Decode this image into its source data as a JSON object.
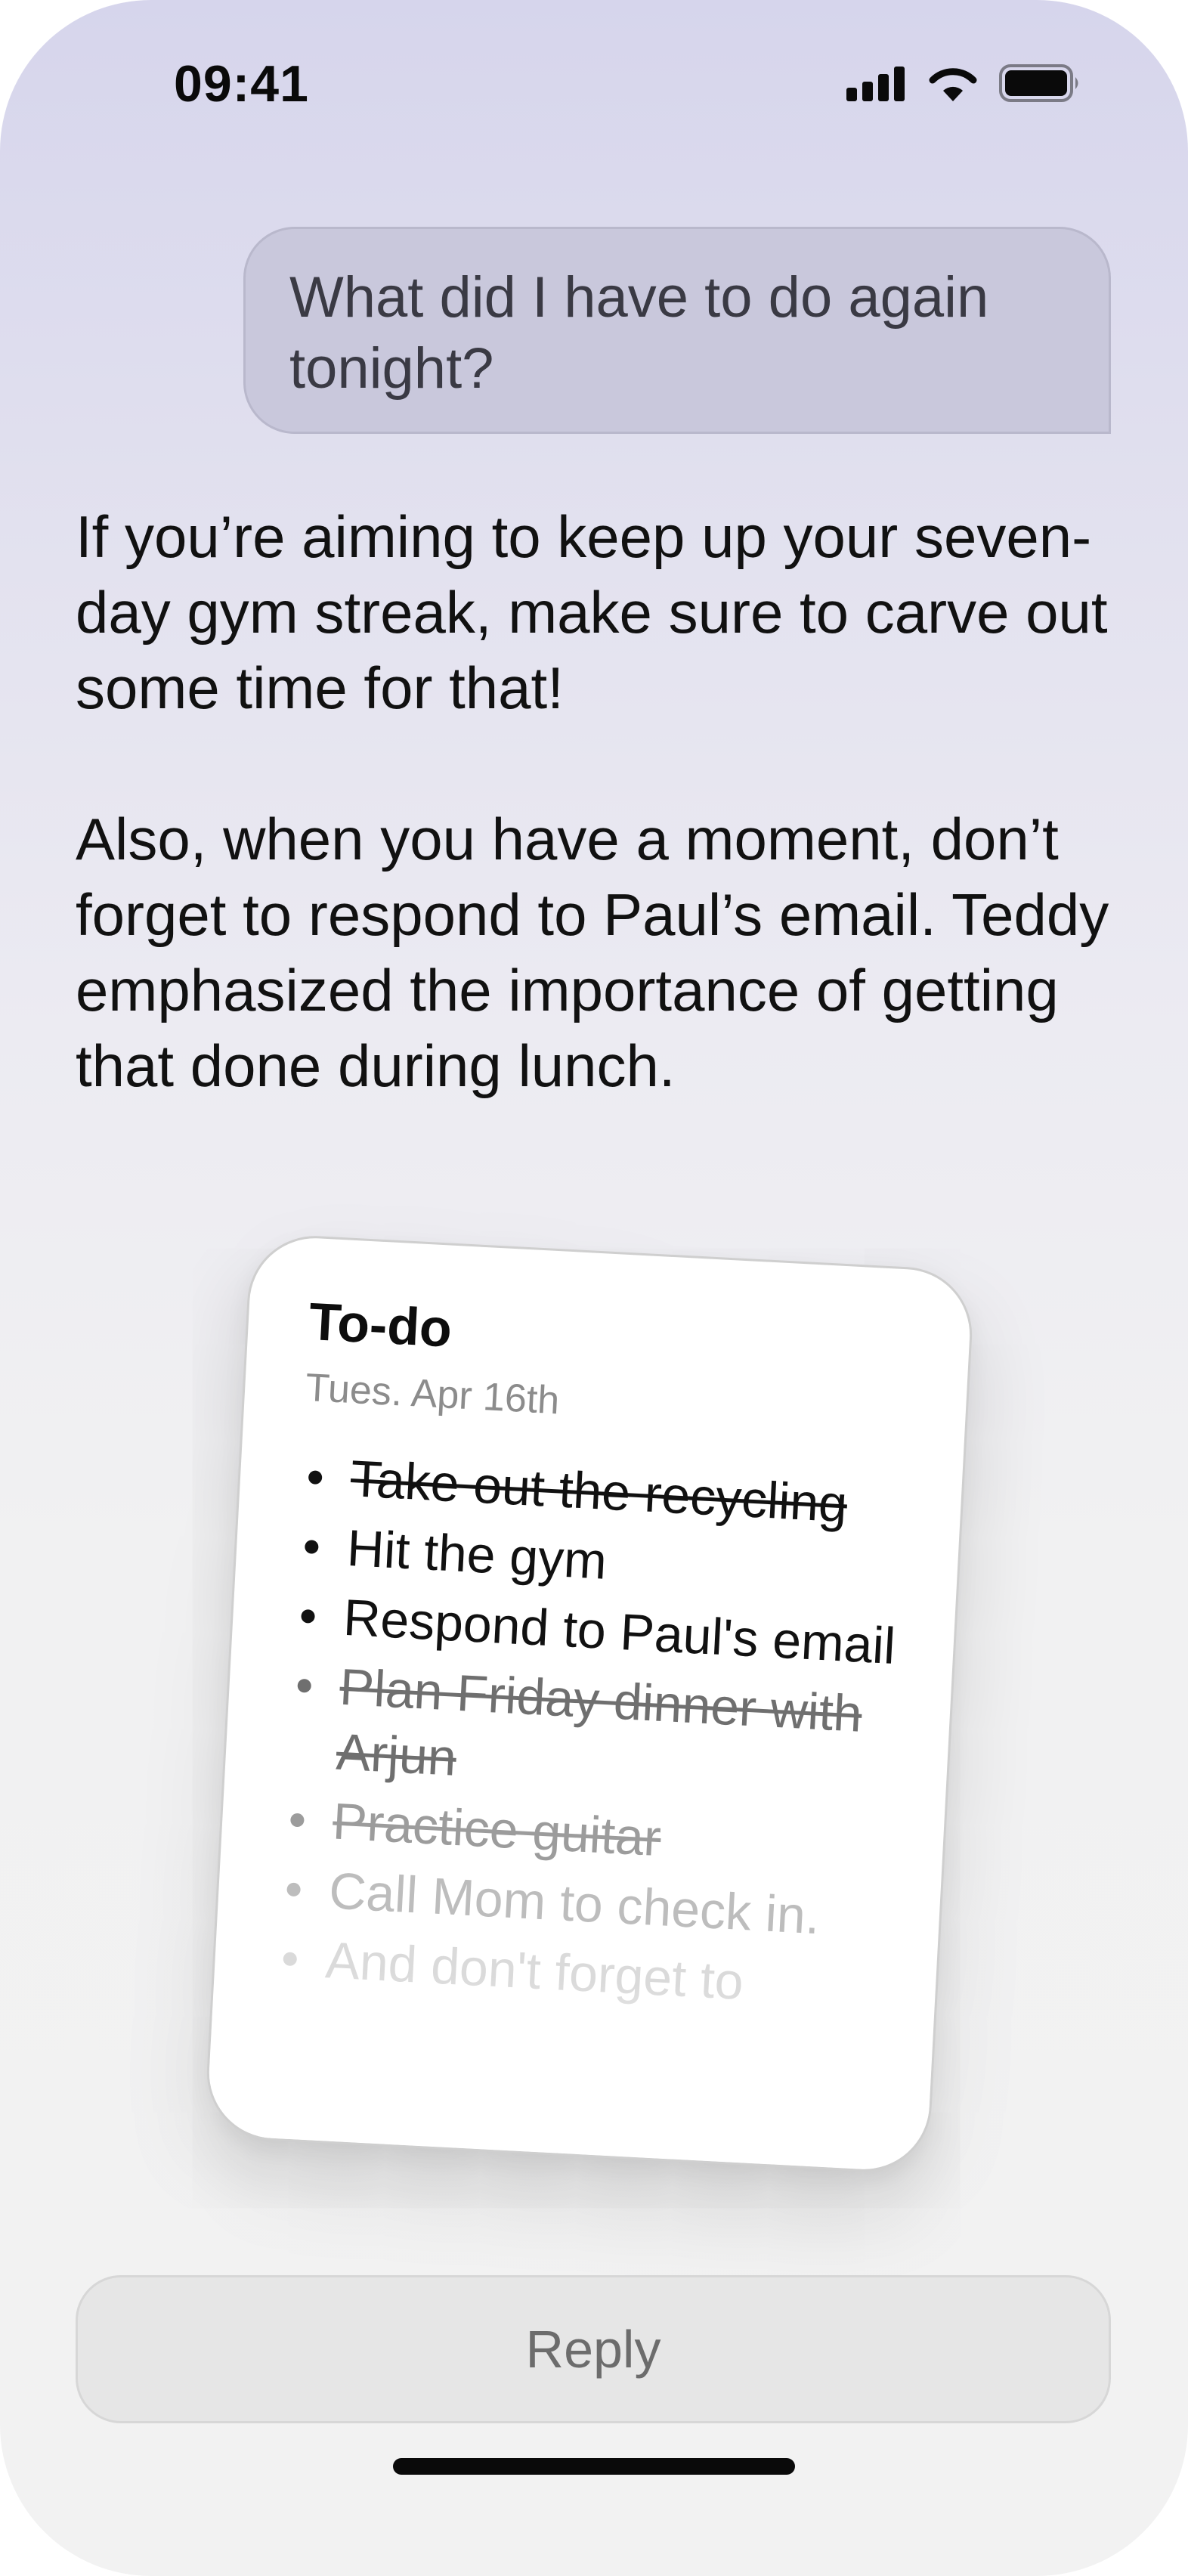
{
  "status_bar": {
    "time": "09:41",
    "icons": [
      "cellular-signal-icon",
      "wifi-icon",
      "battery-icon"
    ]
  },
  "conversation": {
    "user_message": "What did I have to do again tonight?",
    "assistant_paragraphs": [
      "If you’re aiming to keep up your seven-day gym streak, make sure to carve out some time for that!",
      "Also, when you have a moment, don’t forget to respond to Paul’s email. Teddy emphasized the importance of getting that done during lunch."
    ]
  },
  "todo_card": {
    "title": "To-do",
    "date": "Tues. Apr 16th",
    "items": [
      {
        "text": "Take out the recycling",
        "done": true
      },
      {
        "text": "Hit the gym",
        "done": false
      },
      {
        "text": "Respond to Paul's email",
        "done": false
      },
      {
        "text": "Plan Friday dinner with Arjun",
        "done": true
      },
      {
        "text": "Practice guitar",
        "done": true
      },
      {
        "text": "Call Mom to check in.",
        "done": false
      },
      {
        "text": "And don't forget to",
        "done": false
      }
    ]
  },
  "reply": {
    "label": "Reply"
  }
}
